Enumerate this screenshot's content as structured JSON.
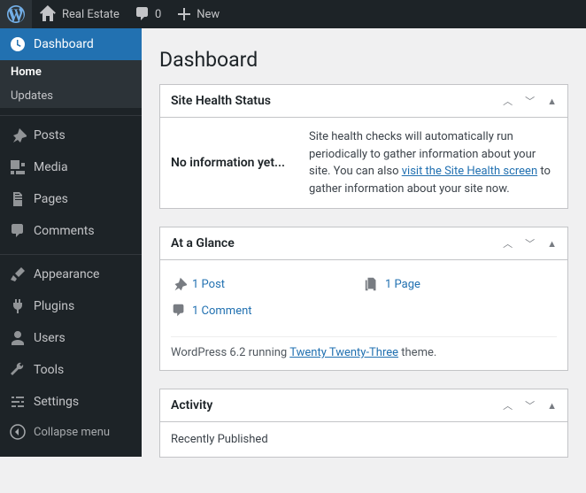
{
  "topbar": {
    "site_name": "Real Estate",
    "comments_count": "0",
    "new_label": "New"
  },
  "sidebar": {
    "dashboard": "Dashboard",
    "home": "Home",
    "updates": "Updates",
    "posts": "Posts",
    "media": "Media",
    "pages": "Pages",
    "comments": "Comments",
    "appearance": "Appearance",
    "plugins": "Plugins",
    "users": "Users",
    "tools": "Tools",
    "settings": "Settings",
    "collapse": "Collapse menu"
  },
  "page": {
    "title": "Dashboard"
  },
  "health": {
    "heading": "Site Health Status",
    "noinfo": "No information yet...",
    "text_before": "Site health checks will automatically run periodically to gather information about your site. You can also ",
    "link": "visit the Site Health screen",
    "text_after": " to gather information about your site now."
  },
  "glance": {
    "heading": "At a Glance",
    "posts": "1 Post",
    "pages": "1 Page",
    "comments": "1 Comment",
    "version_before": "WordPress 6.2 running ",
    "theme_link": "Twenty Twenty-Three",
    "version_after": " theme."
  },
  "activity": {
    "heading": "Activity",
    "recent": "Recently Published"
  }
}
